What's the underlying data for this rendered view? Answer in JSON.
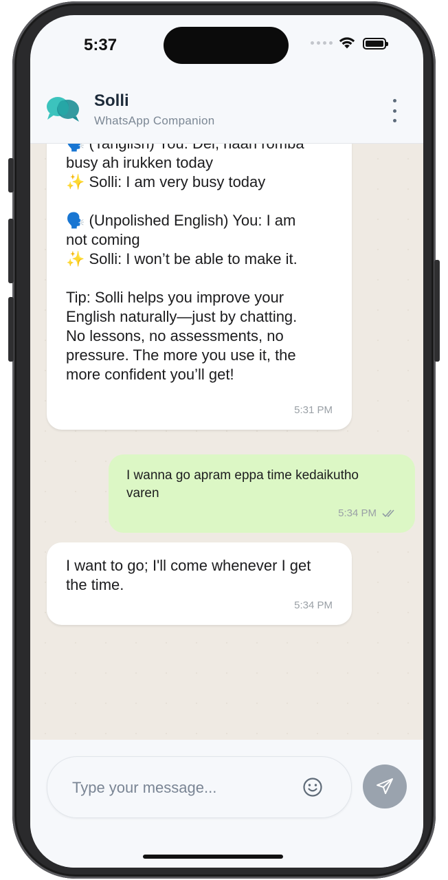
{
  "status": {
    "time": "5:37"
  },
  "header": {
    "title": "Solli",
    "subtitle": "WhatsApp Companion"
  },
  "messages": [
    {
      "side": "incoming",
      "text_partial_top": "🗣️ (Tanglish) You: Dei, naan romba",
      "text": "busy ah irukken today\n✨ Solli: I am very busy today\n\n🗣️ (Unpolished English) You: I am\nnot coming\n✨ Solli: I won’t be able to make it.\n\nTip: Solli helps you improve your\nEnglish naturally—just by chatting.\nNo lessons, no assessments, no\npressure. The more you use it, the\nmore confident you’ll get!",
      "time": "5:31 PM"
    },
    {
      "side": "outgoing",
      "text": "I wanna go apram eppa time kedaikutho\nvaren",
      "time": "5:34 PM",
      "status_icon": "double-check-icon"
    },
    {
      "side": "incoming",
      "text": "I want to go; I'll come whenever I get\nthe time.",
      "time": "5:34 PM"
    }
  ],
  "composer": {
    "placeholder": "Type your message..."
  },
  "colors": {
    "accent": "#2bb5b0",
    "outgoing_bubble": "#dcf7c5",
    "incoming_bubble": "#ffffff",
    "chat_background": "#efeae3",
    "send_button": "#9aa3ae"
  }
}
